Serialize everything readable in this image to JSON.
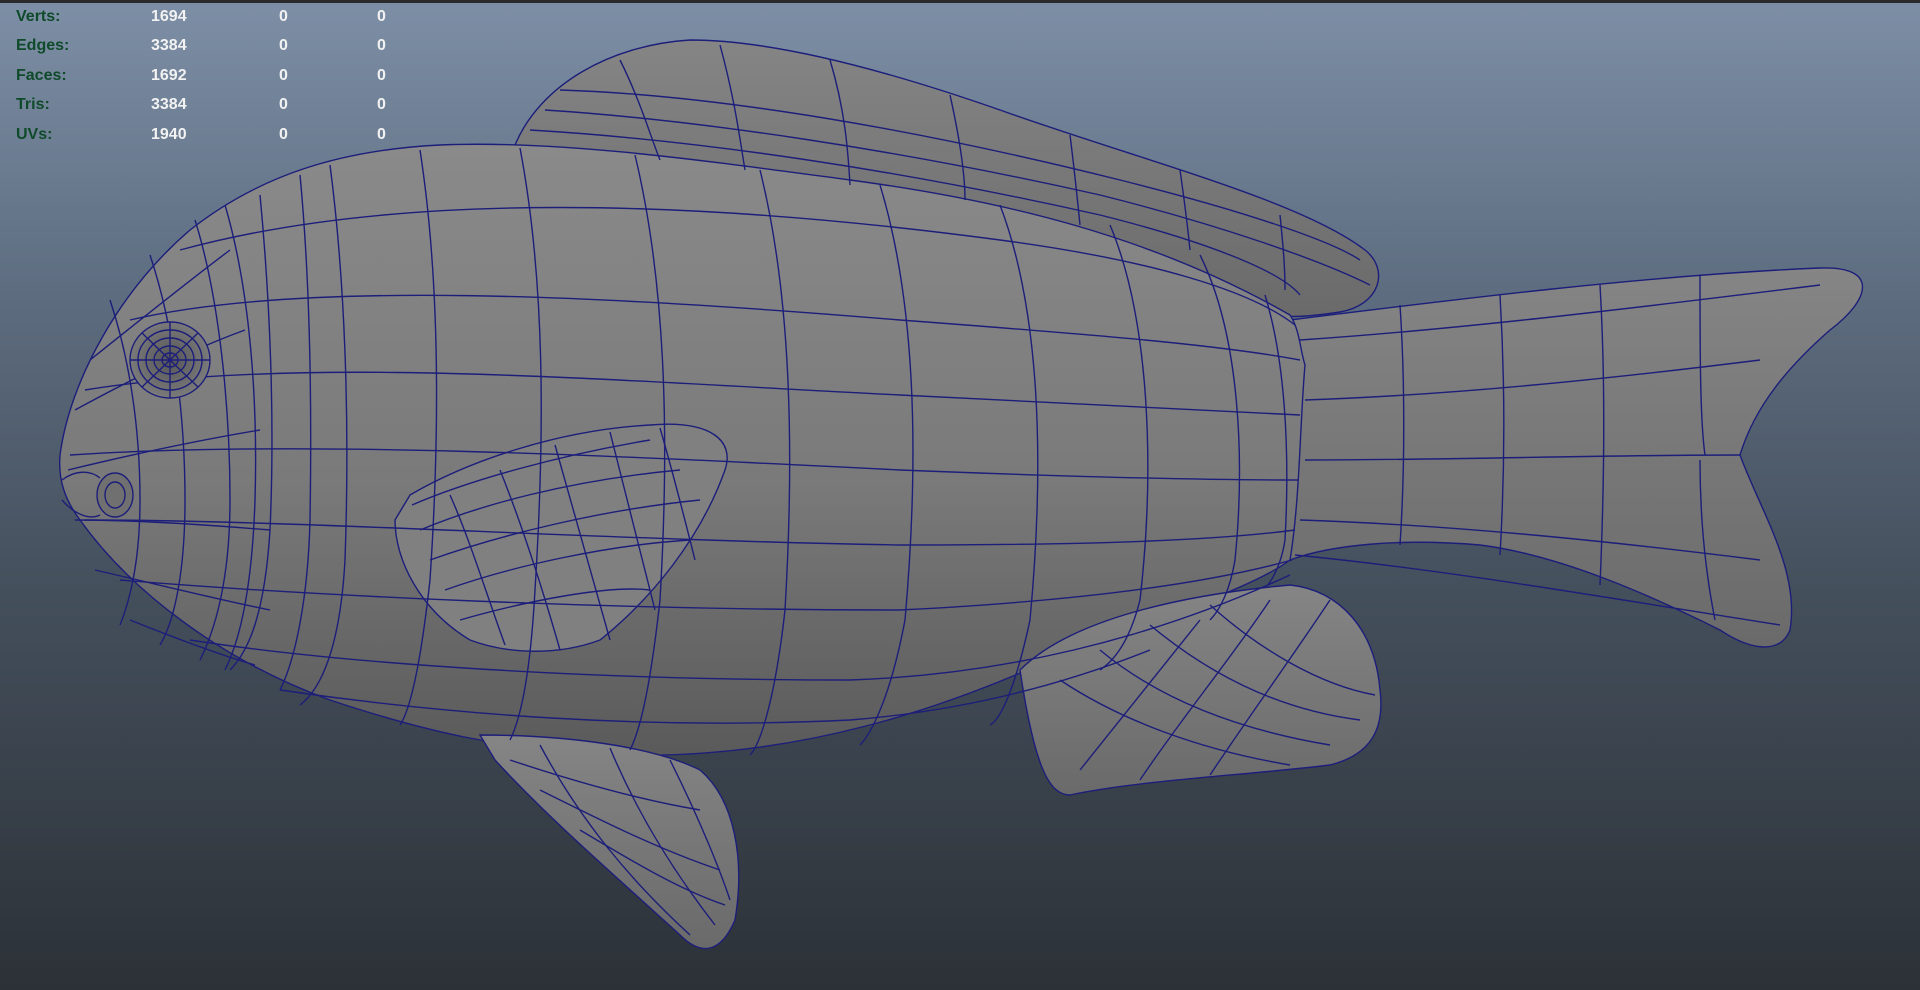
{
  "hud": {
    "rows": [
      {
        "label": "Verts:",
        "value": "1694",
        "selected": "0",
        "component": "0"
      },
      {
        "label": "Edges:",
        "value": "3384",
        "selected": "0",
        "component": "0"
      },
      {
        "label": "Faces:",
        "value": "1692",
        "selected": "0",
        "component": "0"
      },
      {
        "label": "Tris:",
        "value": "3384",
        "selected": "0",
        "component": "0"
      },
      {
        "label": "UVs:",
        "value": "1940",
        "selected": "0",
        "component": "0"
      }
    ]
  },
  "viewport": {
    "object": "fish-mesh",
    "wireframe_color": "#1c1e7a",
    "shade_color": "#7b7b7b",
    "background_top": "#7d8fa6",
    "background_bottom": "#2c3137"
  }
}
